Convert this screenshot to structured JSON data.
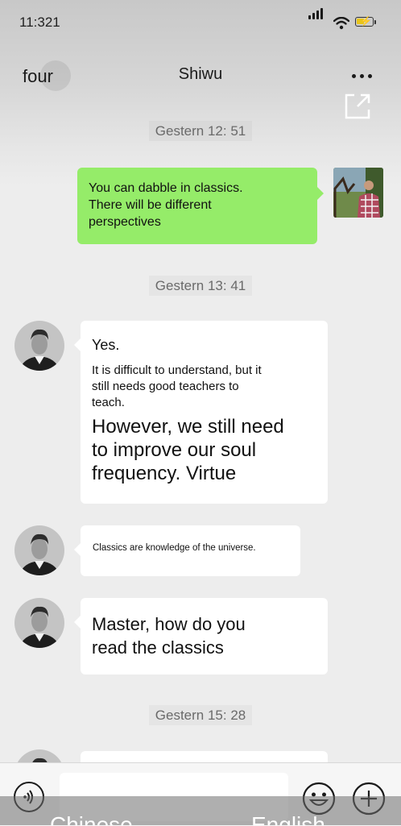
{
  "status_bar": {
    "time": "11:321"
  },
  "navbar": {
    "back_label": "four",
    "title": "Shiwu"
  },
  "timestamps": [
    "Gestern 12: 51",
    "Gestern 13: 41",
    "Gestern 15: 28"
  ],
  "messages": [
    {
      "from": "me",
      "text": "You can dabble in classics.\nThere will be different\nperspectives"
    },
    {
      "from": "contact",
      "lines": [
        "Yes.",
        "It is difficult to understand, but it\nstill needs good teachers to\nteach.",
        "However, we still need\nto improve our soul\nfrequency. Virtue"
      ]
    },
    {
      "from": "contact",
      "text": "Classics are knowledge of the universe."
    },
    {
      "from": "contact",
      "text": "Master, how do you\nread the classics"
    }
  ],
  "translate_bar": {
    "source": "Chinese",
    "arrow": "→",
    "target": "English"
  },
  "colors": {
    "outgoing_bubble": "#95ec69",
    "incoming_bubble": "#ffffff",
    "background": "#ededed"
  },
  "icons": [
    "signal-icon",
    "wifi-icon",
    "battery-charging-icon",
    "more-icon",
    "share-icon",
    "voice-icon",
    "emoji-icon",
    "plus-icon"
  ]
}
